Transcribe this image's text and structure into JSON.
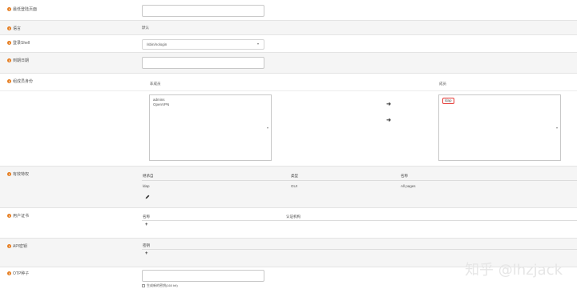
{
  "fields": {
    "home_page": {
      "label": "最低登陆页面",
      "value": ""
    },
    "language": {
      "label": "语言",
      "value": "默认"
    },
    "login_shell": {
      "label": "登录Shell",
      "value": "/sbin/nologin"
    },
    "expiry_date": {
      "label": "到期日期",
      "value": ""
    },
    "group_membership": {
      "label": "组成员身份",
      "not_member_header": "非成员",
      "member_header": "成员",
      "not_member_items": [
        "admins",
        "OpenVPN"
      ],
      "member_items": [
        "ldap"
      ]
    },
    "effective_privileges": {
      "label": "有效特权",
      "columns": [
        "继承自",
        "类型",
        "名称"
      ],
      "rows": [
        [
          "ldap",
          "GUI",
          "All pages"
        ]
      ]
    },
    "user_certificates": {
      "label": "用户证书",
      "columns": [
        "名称",
        "认证机构"
      ]
    },
    "api_keys": {
      "label": "API密钥",
      "columns": [
        "密钥"
      ]
    },
    "otp_seed": {
      "label": "OTP种子",
      "value": "",
      "checkbox_label": "生成新的密钥(160 bit)"
    }
  },
  "watermark": "知乎 @lhzjack",
  "colors": {
    "accent": "#e67e22",
    "highlight": "#e53935"
  }
}
